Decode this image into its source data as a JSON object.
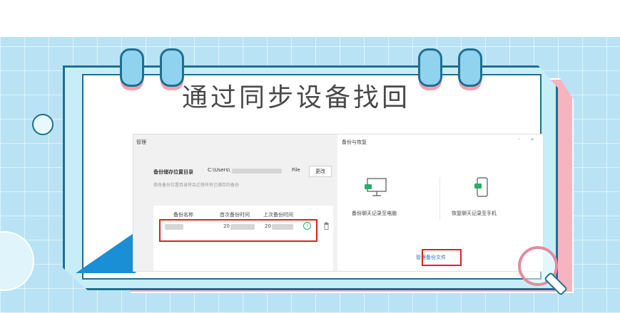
{
  "headline": "通过同步设备找回",
  "left_pane": {
    "title": "管理",
    "storage_label": "备份储存位置目录",
    "storage_path_prefix": "C:\\Users\\",
    "storage_path_suffix": "File",
    "change_button": "更改",
    "hint": "修改备份位置目录将会迁移所有已储存的备份",
    "table_headers": [
      "备份名称",
      "首次备份时间",
      "上次备份时间"
    ],
    "row": {
      "first_time_visible": "20",
      "last_time_visible": "20"
    },
    "info_icon": "info-icon",
    "delete_icon": "trash-icon"
  },
  "right_pane": {
    "title": "备份与恢复",
    "window_controls": "- ×",
    "option_backup": "备份聊天记录至电脑",
    "option_restore": "恢复聊天记录至手机",
    "manage_link": "管理备份文件",
    "backup_icon": "monitor-chat-icon",
    "restore_icon": "phone-chat-icon"
  },
  "colors": {
    "banner": "#b9e3f5",
    "frame": "#1f6f8f",
    "highlight": "#e0231c",
    "accent_green": "#2aae67"
  }
}
